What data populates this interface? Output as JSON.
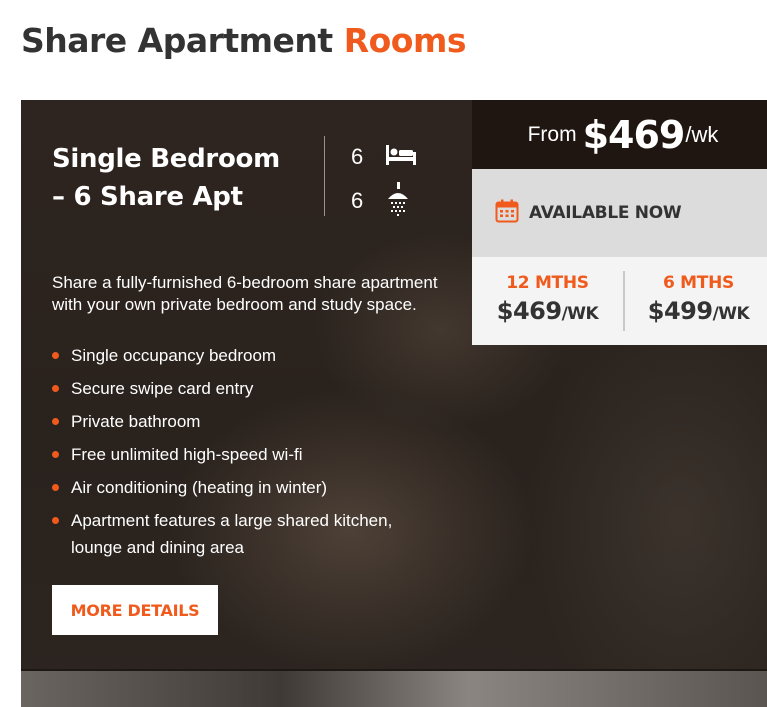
{
  "heading": {
    "main": "Share Apartment",
    "accent": "Rooms"
  },
  "colors": {
    "accent": "#f05a1c",
    "dark_text": "#333333",
    "card_bg": "#2a221d"
  },
  "room": {
    "title": "Single Bedroom – 6 Share Apt",
    "bedrooms": "6",
    "bathrooms": "6",
    "description": "Share a fully-furnished 6-bedroom share apartment with your own private bedroom and study space.",
    "features": [
      "Single occupancy bedroom",
      "Secure swipe card entry",
      "Private bathroom",
      "Free unlimited high-speed wi-fi",
      "Air conditioning (heating in winter)",
      "Apartment features a large shared kitchen, lounge and dining area"
    ],
    "more_button": "MORE DETAILS"
  },
  "pricing": {
    "from_label": "From",
    "from_price": "$469",
    "from_unit": "/wk",
    "availability": "AVAILABLE NOW",
    "terms": [
      {
        "label": "12 MTHS",
        "price": "$469",
        "unit": "/WK"
      },
      {
        "label": "6 MTHS",
        "price": "$499",
        "unit": "/WK"
      }
    ]
  },
  "icons": {
    "bed": "bed-icon",
    "shower": "shower-icon",
    "calendar": "calendar-icon"
  }
}
